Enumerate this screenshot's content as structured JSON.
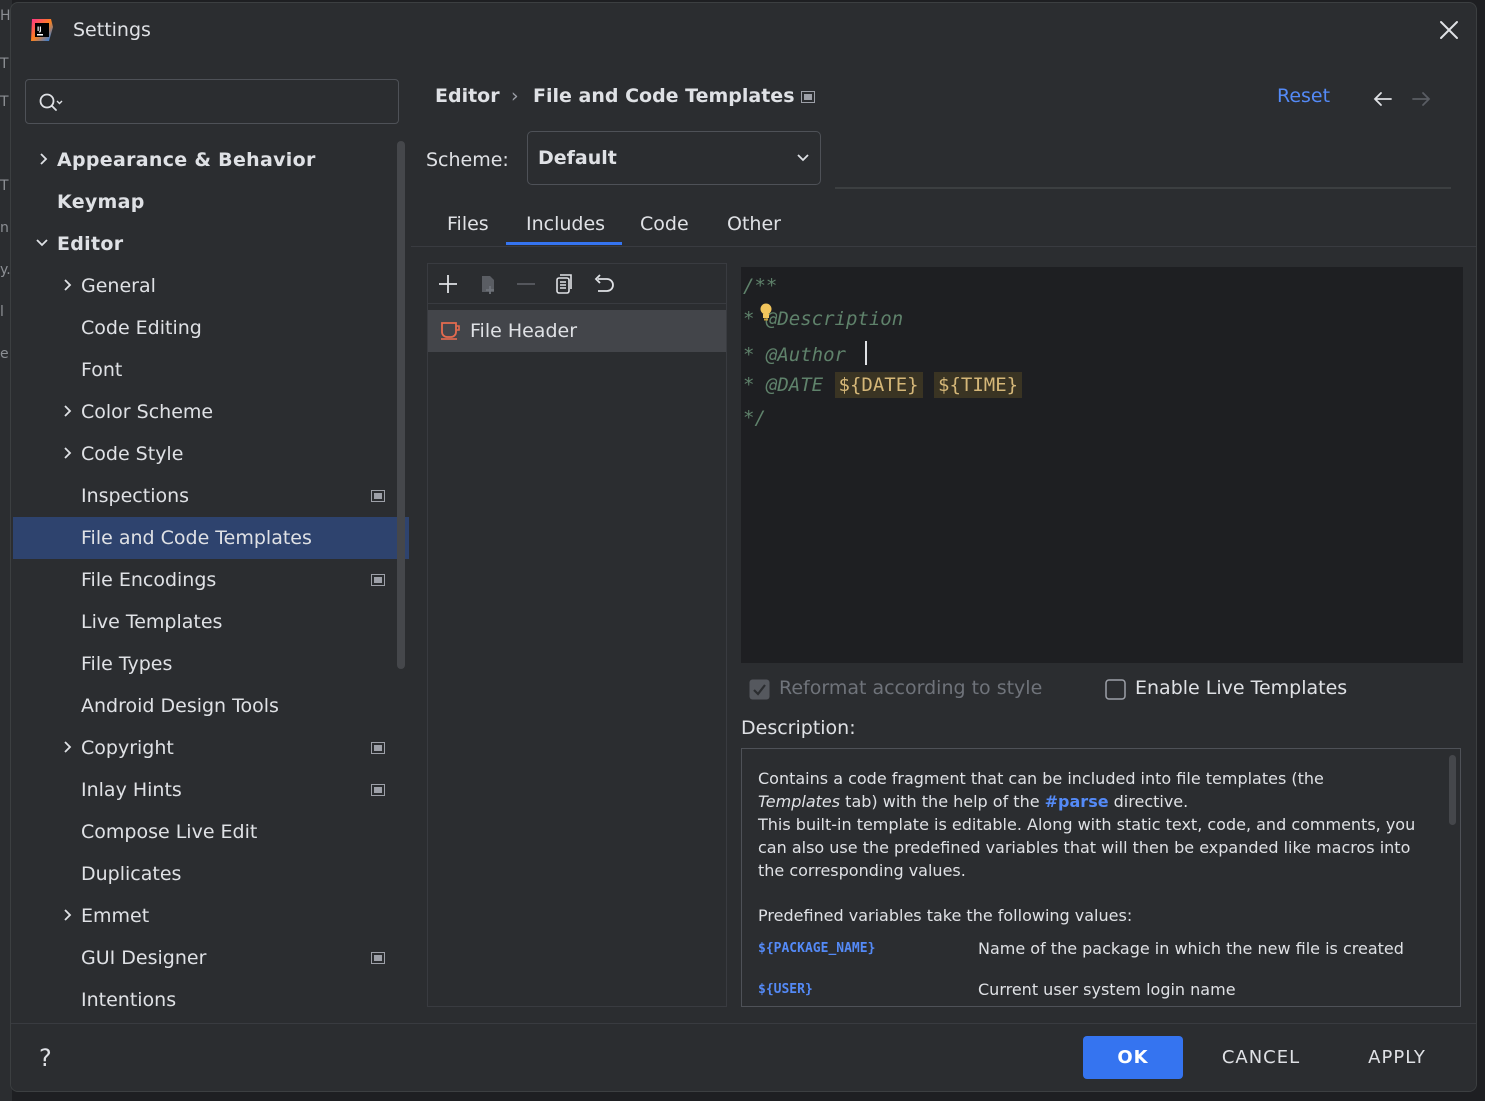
{
  "window": {
    "title": "Settings"
  },
  "search": {
    "placeholder": "",
    "value": ""
  },
  "background_edge": [
    "H",
    "T",
    "T",
    "T",
    "n",
    "y.",
    "l",
    "e"
  ],
  "tree": {
    "items": [
      {
        "label": "Appearance & Behavior",
        "level": 0,
        "expandable": true,
        "expanded": false,
        "bold": true
      },
      {
        "label": "Keymap",
        "level": 0,
        "expandable": false,
        "bold": true
      },
      {
        "label": "Editor",
        "level": 0,
        "expandable": true,
        "expanded": true,
        "bold": true
      },
      {
        "label": "General",
        "level": 1,
        "expandable": true,
        "expanded": false
      },
      {
        "label": "Code Editing",
        "level": 1
      },
      {
        "label": "Font",
        "level": 1
      },
      {
        "label": "Color Scheme",
        "level": 1,
        "expandable": true,
        "expanded": false
      },
      {
        "label": "Code Style",
        "level": 1,
        "expandable": true,
        "expanded": false
      },
      {
        "label": "Inspections",
        "level": 1,
        "project_icon": true
      },
      {
        "label": "File and Code Templates",
        "level": 1,
        "selected": true
      },
      {
        "label": "File Encodings",
        "level": 1,
        "project_icon": true
      },
      {
        "label": "Live Templates",
        "level": 1
      },
      {
        "label": "File Types",
        "level": 1
      },
      {
        "label": "Android Design Tools",
        "level": 1
      },
      {
        "label": "Copyright",
        "level": 1,
        "expandable": true,
        "expanded": false,
        "project_icon": true
      },
      {
        "label": "Inlay Hints",
        "level": 1,
        "project_icon": true
      },
      {
        "label": "Compose Live Edit",
        "level": 1
      },
      {
        "label": "Duplicates",
        "level": 1
      },
      {
        "label": "Emmet",
        "level": 1,
        "expandable": true,
        "expanded": false
      },
      {
        "label": "GUI Designer",
        "level": 1,
        "project_icon": true
      },
      {
        "label": "Intentions",
        "level": 1
      }
    ]
  },
  "breadcrumb": {
    "parent": "Editor",
    "separator": "›",
    "current": "File and Code Templates"
  },
  "header": {
    "reset_label": "Reset"
  },
  "scheme": {
    "label": "Scheme:",
    "value": "Default"
  },
  "tabs": [
    {
      "label": "Files"
    },
    {
      "label": "Includes",
      "active": true
    },
    {
      "label": "Code"
    },
    {
      "label": "Other"
    }
  ],
  "template_list": {
    "toolbar_icons": [
      "add-icon",
      "add-child-icon",
      "remove-icon",
      "copy-icon",
      "revert-icon"
    ],
    "items": [
      {
        "label": "File Header",
        "icon": "java-coffee-icon",
        "selected": true
      }
    ]
  },
  "editor": {
    "lines": [
      {
        "text": "/**"
      },
      {
        "text": "* @Description"
      },
      {
        "text": "* @Author "
      },
      {
        "prefix": "* @DATE ",
        "var1": "${DATE}",
        "var2": "${TIME}"
      },
      {
        "text": "*/"
      }
    ]
  },
  "options": {
    "reformat": {
      "label": "Reformat according to style",
      "checked": true,
      "enabled": false
    },
    "live_templates": {
      "label": "Enable Live Templates",
      "checked": false,
      "enabled": true
    }
  },
  "description": {
    "label": "Description:",
    "p1_a": "Contains a code fragment that can be included into file templates (the",
    "p1_b_italic": "Templates",
    "p1_c": " tab) with the help of the ",
    "p1_kw": "#parse",
    "p1_d": " directive.",
    "p2": "This built-in template is editable. Along with static text, code, and comments, you can also use the predefined variables that will then be expanded like macros into the corresponding values.",
    "p3": "Predefined variables take the following values:",
    "variables": [
      {
        "name": "${PACKAGE_NAME}",
        "desc": "Name of the package in which the new file is created"
      },
      {
        "name": "${USER}",
        "desc": "Current user system login name"
      }
    ]
  },
  "footer": {
    "help_label": "?",
    "ok_label": "OK",
    "cancel_label": "CANCEL",
    "apply_label": "APPLY"
  },
  "colors": {
    "accent": "#3574f0",
    "link": "#548af7",
    "selection": "#2e436e",
    "comment": "#5f826b",
    "template_var": "#d5b778"
  }
}
